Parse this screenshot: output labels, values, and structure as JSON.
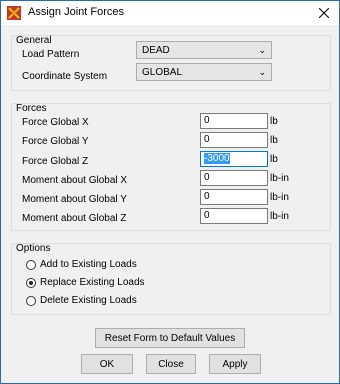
{
  "window": {
    "title": "Assign Joint Forces"
  },
  "general": {
    "title": "General",
    "load_pattern_label": "Load Pattern",
    "load_pattern_value": "DEAD",
    "coord_system_label": "Coordinate System",
    "coord_system_value": "GLOBAL"
  },
  "forces": {
    "title": "Forces",
    "rows": [
      {
        "label": "Force Global X",
        "value": "0",
        "unit": "lb"
      },
      {
        "label": "Force Global Y",
        "value": "0",
        "unit": "lb"
      },
      {
        "label": "Force Global Z",
        "value": "-3000",
        "unit": "lb"
      },
      {
        "label": "Moment about Global X",
        "value": "0",
        "unit": "lb-in"
      },
      {
        "label": "Moment about Global Y",
        "value": "0",
        "unit": "lb-in"
      },
      {
        "label": "Moment about Global Z",
        "value": "0",
        "unit": "lb-in"
      }
    ]
  },
  "options": {
    "title": "Options",
    "items": [
      {
        "label": "Add to Existing Loads",
        "selected": false
      },
      {
        "label": "Replace Existing Loads",
        "selected": true
      },
      {
        "label": "Delete Existing Loads",
        "selected": false
      }
    ]
  },
  "buttons": {
    "reset": "Reset Form to Default Values",
    "ok": "OK",
    "close": "Close",
    "apply": "Apply"
  },
  "colors": {
    "selection": "#3399ff",
    "border_accent": "#2b6cb0"
  }
}
